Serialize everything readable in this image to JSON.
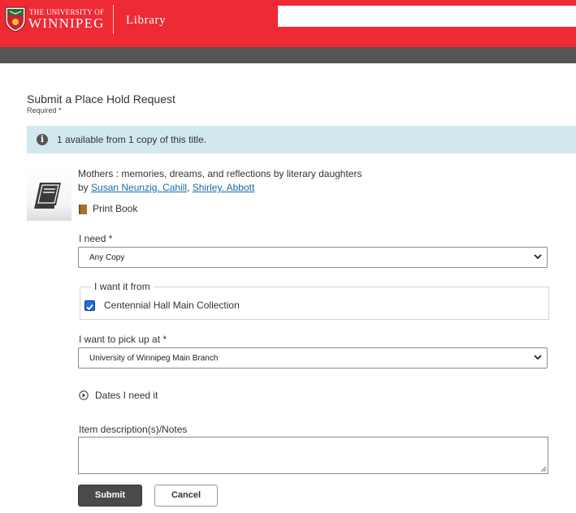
{
  "header": {
    "university_small": "THE UNIVERSITY OF",
    "university_name": "WINNIPEG",
    "section": "Library",
    "search_value": ""
  },
  "page": {
    "title": "Submit a Place Hold Request",
    "required_note": "Required *"
  },
  "alert": {
    "text": "1 available from 1 copy of this title."
  },
  "item": {
    "title": "Mothers : memories, dreams, and reflections by literary daughters",
    "by_prefix": "by",
    "authors": [
      "Susan Neunzig. Cahill",
      "Shirley. Abbott"
    ],
    "author_sep": ",",
    "format": "Print Book"
  },
  "form": {
    "need_label": "I need *",
    "need_value": "Any Copy",
    "from_legend": "I want it from",
    "from_option": "Centennial Hall Main Collection",
    "from_checked": true,
    "pickup_label": "I want to pick up at *",
    "pickup_value": "University of Winnipeg Main Branch",
    "dates_label": "Dates I need it",
    "notes_label": "Item description(s)/Notes",
    "notes_value": "",
    "submit_label": "Submit",
    "cancel_label": "Cancel"
  },
  "colors": {
    "brand_red": "#ee2a35",
    "bar_gray": "#555555",
    "alert_bg": "#d1e8ef",
    "link": "#1a6ba8"
  }
}
